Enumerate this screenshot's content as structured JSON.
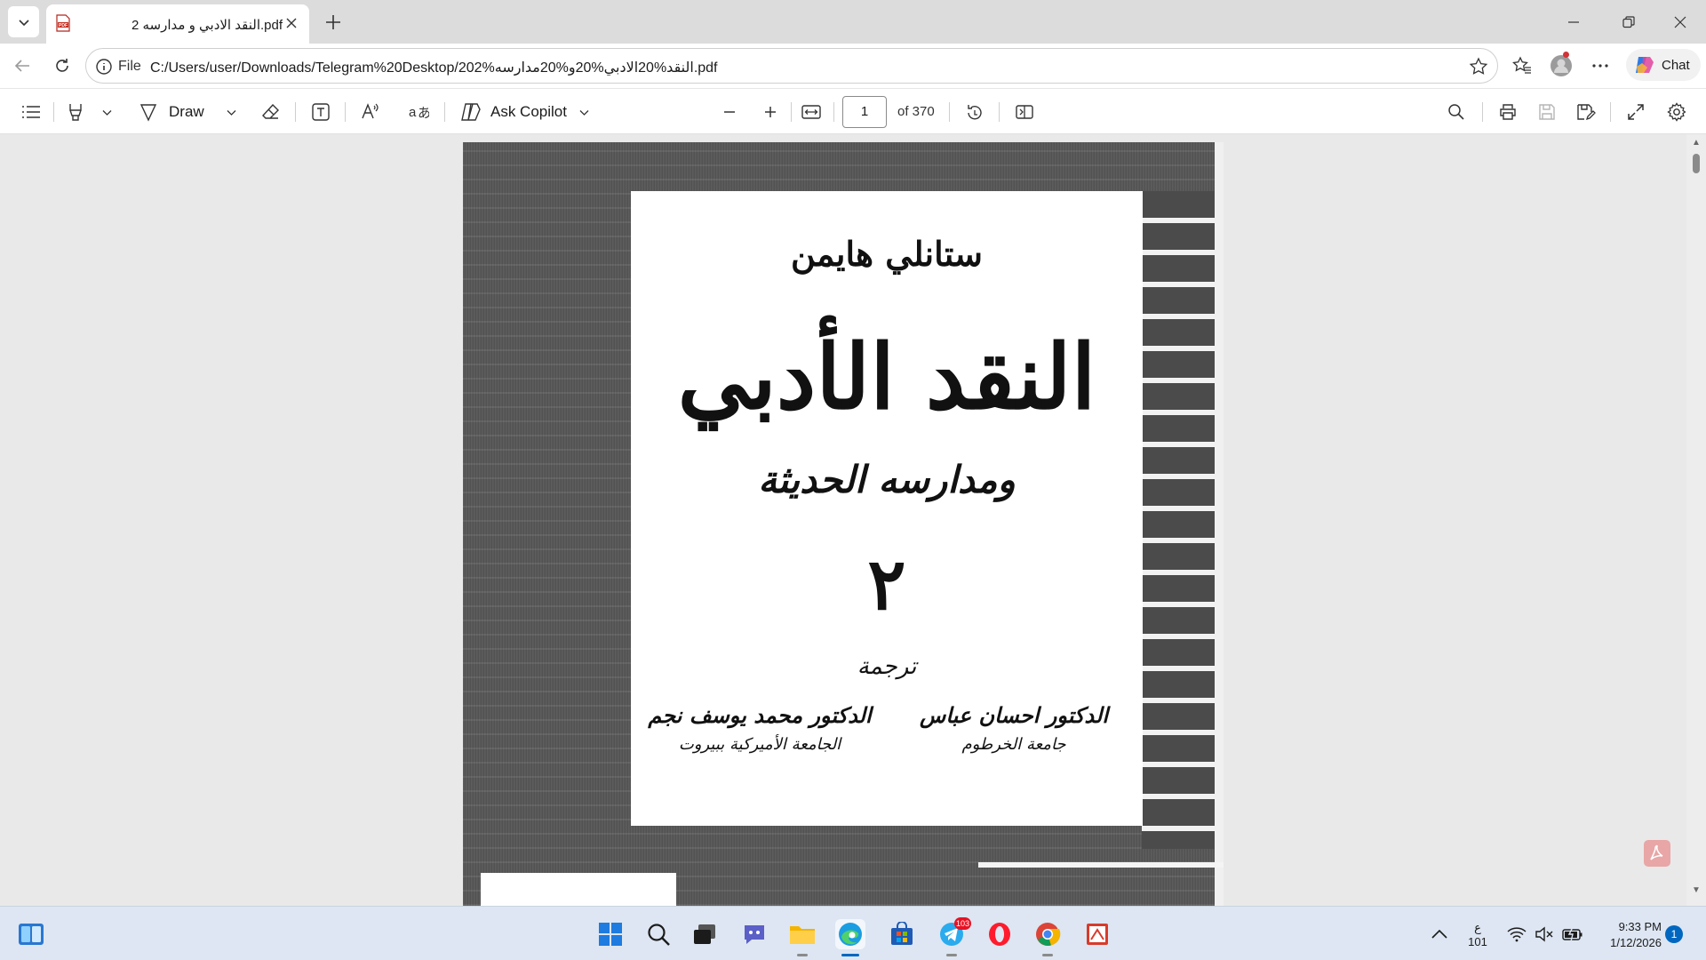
{
  "tab": {
    "title": "النقد الادبي و مدارسه 2.pdf",
    "favicon": "pdf-file-icon"
  },
  "address": {
    "scheme_label": "File",
    "url": "C:/Users/user/Downloads/Telegram%20Desktop/النقد%20الادبي%20و%20مدارسه%202.pdf"
  },
  "copilot": {
    "chat_label": "Chat"
  },
  "pdf_toolbar": {
    "draw_label": "Draw",
    "ask_copilot_label": "Ask Copilot",
    "current_page": "1",
    "total_pages_label": "of 370"
  },
  "document": {
    "author": "ستانلي هايمن",
    "title": "النقد الأدبي",
    "subtitle": "ومدارسه الحديثة",
    "volume": "٢",
    "translation_label": "ترجمة",
    "translator_1": "الدكتور احسان عباس",
    "translator_1_affiliation": "جامعة الخرطوم",
    "translator_2": "الدكتور محمد يوسف نجم",
    "translator_2_affiliation": "الجامعة الأميركية ببيروت"
  },
  "taskbar": {
    "ime_label": "ع",
    "ime_sub": "101",
    "time": "9:33 PM",
    "date": "1/12/2026",
    "notification_count": "1",
    "telegram_badge": "103"
  },
  "colors": {
    "accent": "#0067c0",
    "toolbar_bg": "#ffffff",
    "tabstrip_bg": "#dcdcdc",
    "taskbar_bg": "#dde6f2"
  }
}
